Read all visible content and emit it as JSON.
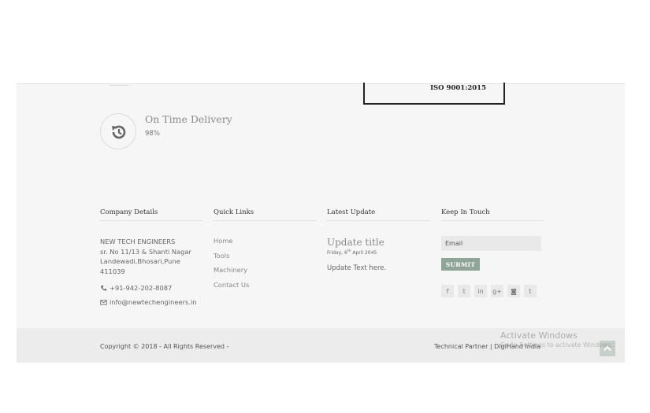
{
  "certificate": {
    "text": "ISO 9001:2015"
  },
  "feature": {
    "title": "On Time Delivery",
    "value": "98%",
    "icon": "history-icon"
  },
  "company": {
    "heading": "Company Details",
    "address_lines": [
      "NEW TECH ENGINEERS",
      "sr. No 11/13 & Shanti Nagar",
      "Landewadi,Bhosari,Pune",
      "411039"
    ],
    "phone": "+91-942-202-8087",
    "email": "info@newtechengineers.in"
  },
  "quick_links": {
    "heading": "Quick Links",
    "items": [
      "Home",
      "Tools",
      "Machinery",
      "Contact Us"
    ]
  },
  "latest_update": {
    "heading": "Latest Update",
    "title": "Update title",
    "date_prefix": "Friday, 6",
    "date_sup": "th",
    "date_suffix": " April 2045",
    "text": "Update Text here."
  },
  "keep_in_touch": {
    "heading": "Keep In Touch",
    "email_placeholder": "Email",
    "submit_label": "SUBMIT",
    "socials": [
      {
        "name": "facebook-icon",
        "glyph": "f"
      },
      {
        "name": "twitter-icon",
        "glyph": "𝕥"
      },
      {
        "name": "linkedin-icon",
        "glyph": "in"
      },
      {
        "name": "google-plus-icon",
        "glyph": "g+"
      },
      {
        "name": "instagram-icon",
        "glyph": "◙"
      },
      {
        "name": "tumblr-icon",
        "glyph": "t"
      }
    ]
  },
  "bottom": {
    "copyright": "Copyright © 2018 - All Rights Reserved -",
    "partner": "Technical Partner | DigiHand India"
  },
  "watermark": {
    "line1": "Activate Windows",
    "line2": "Go to Settings to activate Windows."
  },
  "colors": {
    "submit": "#8fa597",
    "footer_bg": "#f6f6f6",
    "bottom_bg": "#ececec"
  }
}
